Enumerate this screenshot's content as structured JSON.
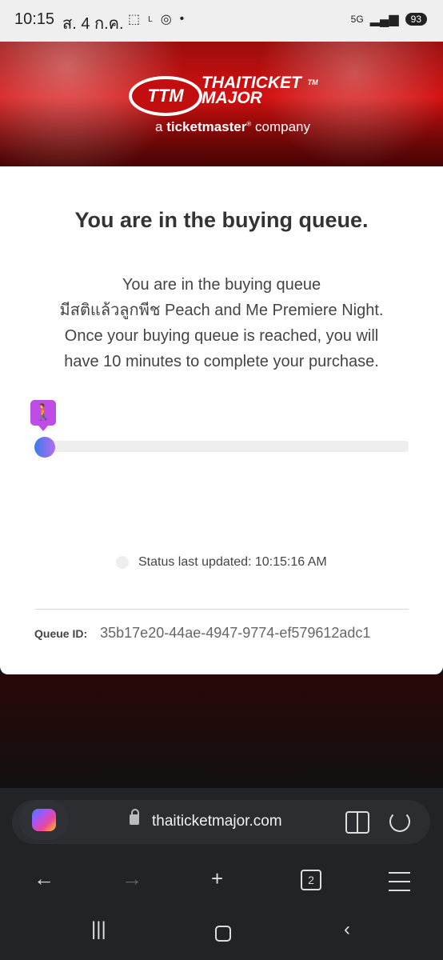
{
  "status_bar": {
    "time": "10:15",
    "date": "ส. 4 ก.ค.",
    "network": "5G",
    "battery": "93",
    "icons": [
      "screenshot-icon",
      "lotus-icon",
      "instagram-icon",
      "dot-icon"
    ]
  },
  "banner": {
    "logo_mark": "TTM",
    "brand_line1": "THAITICKET",
    "brand_line2": "MAJOR",
    "tm": "TM",
    "tagline_prefix": "a",
    "tagline_brand": "ticketmaster",
    "tagline_suffix": "company"
  },
  "queue": {
    "title": "You are in the buying queue.",
    "message_line1": "You are in the buying queue",
    "message_line2": "มีสติแล้วลูกพีช Peach and Me Premiere Night.",
    "message_line3": "Once your buying queue is reached, you will",
    "message_line4": "have 10 minutes to complete your purchase.",
    "progress": 0,
    "status_updated": "Status last updated: 10:15:16 AM",
    "queue_id_label": "Queue ID:",
    "queue_id_value": "35b17e20-44ae-4947-9774-ef579612adc1"
  },
  "browser": {
    "url": "thaiticketmajor.com",
    "tab_count": "2"
  }
}
